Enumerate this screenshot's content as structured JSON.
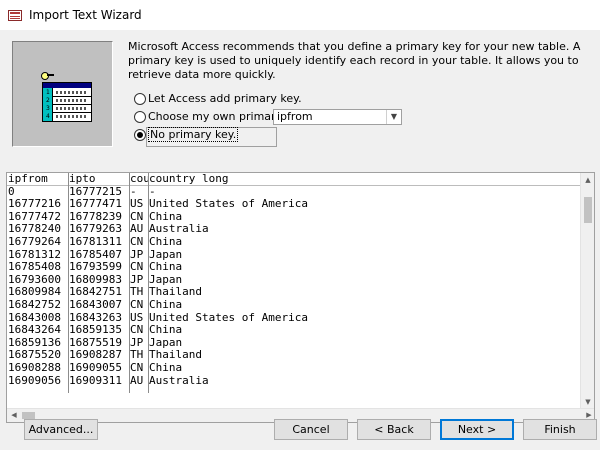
{
  "window": {
    "title": "Import Text Wizard"
  },
  "intro_text": "Microsoft Access recommends that you define a primary key for your new table. A primary key is used to uniquely identify each record in your table. It allows you to retrieve data more quickly.",
  "options": [
    {
      "label": "Let Access add primary key.",
      "checked": false
    },
    {
      "label": "Choose my own primary key.",
      "checked": false
    },
    {
      "label": "No primary key.",
      "checked": true
    }
  ],
  "key_field": {
    "selected": "ipfrom"
  },
  "grid": {
    "columns": [
      "ipfrom",
      "ipto",
      "country",
      "country long"
    ],
    "column_header_visible": [
      "ipfrom",
      "ipto",
      "cou",
      "country long"
    ],
    "rows": [
      [
        "0",
        "16777215",
        "-",
        "-"
      ],
      [
        "16777216",
        "16777471",
        "US",
        "United States of America"
      ],
      [
        "16777472",
        "16778239",
        "CN",
        "China"
      ],
      [
        "16778240",
        "16779263",
        "AU",
        "Australia"
      ],
      [
        "16779264",
        "16781311",
        "CN",
        "China"
      ],
      [
        "16781312",
        "16785407",
        "JP",
        "Japan"
      ],
      [
        "16785408",
        "16793599",
        "CN",
        "China"
      ],
      [
        "16793600",
        "16809983",
        "JP",
        "Japan"
      ],
      [
        "16809984",
        "16842751",
        "TH",
        "Thailand"
      ],
      [
        "16842752",
        "16843007",
        "CN",
        "China"
      ],
      [
        "16843008",
        "16843263",
        "US",
        "United States of America"
      ],
      [
        "16843264",
        "16859135",
        "CN",
        "China"
      ],
      [
        "16859136",
        "16875519",
        "JP",
        "Japan"
      ],
      [
        "16875520",
        "16908287",
        "TH",
        "Thailand"
      ],
      [
        "16908288",
        "16909055",
        "CN",
        "China"
      ],
      [
        "16909056",
        "16909311",
        "AU",
        "Australia"
      ]
    ]
  },
  "buttons": {
    "advanced": "Advanced...",
    "cancel": "Cancel",
    "back": "< Back",
    "next": "Next >",
    "finish": "Finish"
  },
  "illustration_numbers": [
    "1",
    "2",
    "3",
    "4"
  ],
  "colors": {
    "panel_bg": "#f0f0f0",
    "illustration_bg": "#c0c0c0",
    "key_column": "#00c0c0",
    "table_header": "#00007f",
    "default_button_border": "#0078d7"
  }
}
